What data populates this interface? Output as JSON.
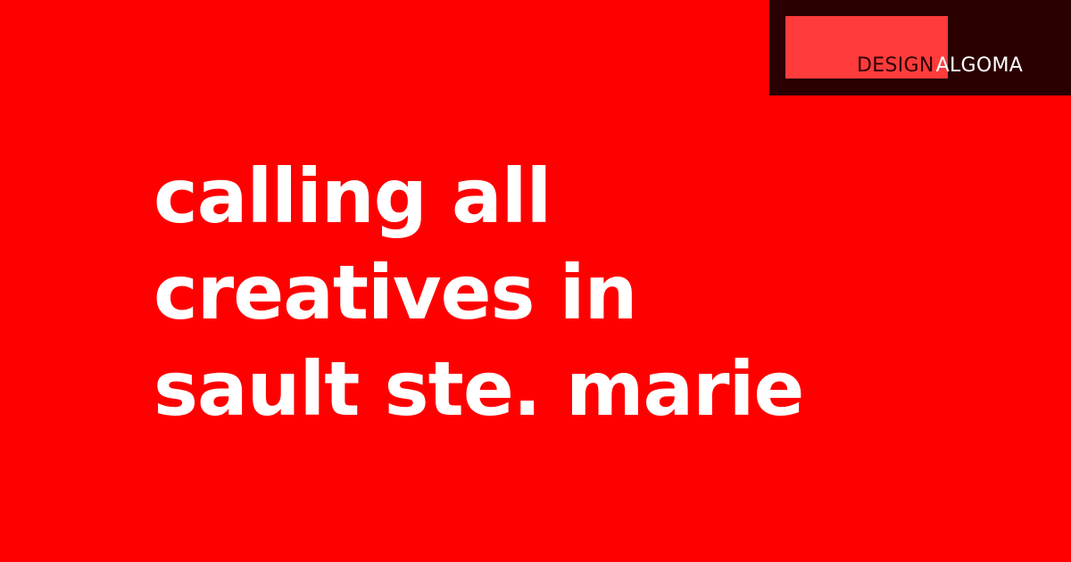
{
  "colors": {
    "background": "#ff0000",
    "logo_box": "#2b0000",
    "logo_swatch": "#ff3b3b",
    "headline_text": "#ffffff"
  },
  "logo": {
    "word1": "DESIGN",
    "word2": "ALGOMA"
  },
  "headline": {
    "lines": [
      "calling all",
      "creatives in",
      "sault ste. marie"
    ]
  }
}
